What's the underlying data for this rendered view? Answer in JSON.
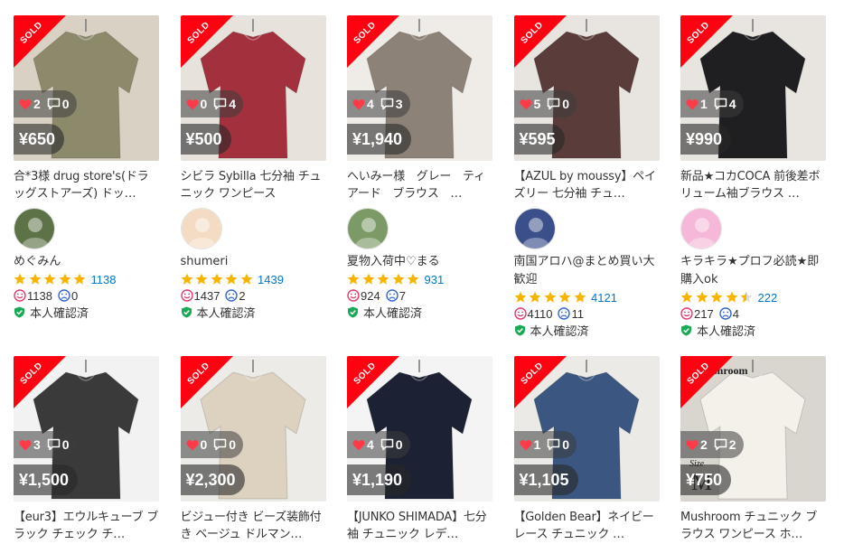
{
  "sold_label": "SOLD",
  "colors": {
    "sold": "#ff0211",
    "heart": "#ff3b4a",
    "star": "#f8b500",
    "link": "#0077c8",
    "good_face": "#e23a6b",
    "bad_face": "#3366cc",
    "verified": "#1aaa55"
  },
  "row1": [
    {
      "likes": "2",
      "comments": "0",
      "price": "¥650",
      "title": "合*3様 drug store's(ドラッグストアーズ) ドッ…",
      "seller": "めぐみん",
      "stars": 5,
      "rating_count": "1138",
      "good": "1138",
      "bad": "0",
      "verified": "本人確認済",
      "bg": "#d9d2c4",
      "garment": "#8d8a6c",
      "avatar_bg": "#5d7247"
    },
    {
      "likes": "0",
      "comments": "4",
      "price": "¥500",
      "title": "シビラ Sybilla 七分袖 チュニック ワンピース",
      "seller": "shumeri",
      "stars": 5,
      "rating_count": "1439",
      "good": "1437",
      "bad": "2",
      "verified": "本人確認済",
      "bg": "#e7e2dc",
      "garment": "#a2313d",
      "avatar_bg": "#f3dcc3"
    },
    {
      "likes": "4",
      "comments": "3",
      "price": "¥1,940",
      "title": "へいみー様　グレー　ティアード　ブラウス　…",
      "seller": "夏物入荷中♡まる",
      "stars": 5,
      "rating_count": "931",
      "good": "924",
      "bad": "7",
      "verified": "本人確認済",
      "bg": "#efece7",
      "garment": "#8d8278",
      "avatar_bg": "#7c9a66"
    },
    {
      "likes": "5",
      "comments": "0",
      "price": "¥595",
      "title": "【AZUL by moussy】ペイズリー 七分袖 チュ…",
      "seller": "南国アロハ@まとめ買い大歓迎",
      "stars": 5,
      "rating_count": "4121",
      "good": "4110",
      "bad": "11",
      "verified": "本人確認済",
      "bg": "#e8e5e1",
      "garment": "#5a3c3a",
      "avatar_bg": "#3b4f8a"
    },
    {
      "likes": "1",
      "comments": "4",
      "price": "¥990",
      "title": "新品★コカCOCA 前後差ボリューム袖ブラウス …",
      "seller": "キラキラ★プロフ必読★即購入ok",
      "stars": 4.5,
      "rating_count": "222",
      "good": "217",
      "bad": "4",
      "verified": "本人確認済",
      "bg": "#e8e4df",
      "garment": "#1f1f22",
      "avatar_bg": "#f5b8d8"
    }
  ],
  "row2": [
    {
      "likes": "3",
      "comments": "0",
      "price": "¥1,500",
      "title": "【eur3】エウルキューブ ブラック チェック チ…",
      "bg": "#f2f2f2",
      "garment": "#3a3a3a"
    },
    {
      "likes": "0",
      "comments": "0",
      "price": "¥2,300",
      "title": "ビジュー付き ビーズ装飾付き ベージュ ドルマン…",
      "bg": "#ecebe8",
      "garment": "#ddd2c0"
    },
    {
      "likes": "4",
      "comments": "0",
      "price": "¥1,190",
      "title": "【JUNKO SHIMADA】七分袖 チュニック レデ…",
      "bg": "#f4f4f4",
      "garment": "#1c2233"
    },
    {
      "likes": "1",
      "comments": "0",
      "price": "¥1,105",
      "title": "【Golden Bear】ネイビー レース チュニック …",
      "bg": "#eceae6",
      "garment": "#3b5680"
    },
    {
      "likes": "2",
      "comments": "2",
      "price": "¥750",
      "title": "Mushroom チュニック ブラウス ワンピース ホ…",
      "bg": "#d9d6d0",
      "garment": "#f4f1ea",
      "photo_text": "Mushroom",
      "photo_text2": "Size",
      "photo_text3": "M"
    }
  ]
}
